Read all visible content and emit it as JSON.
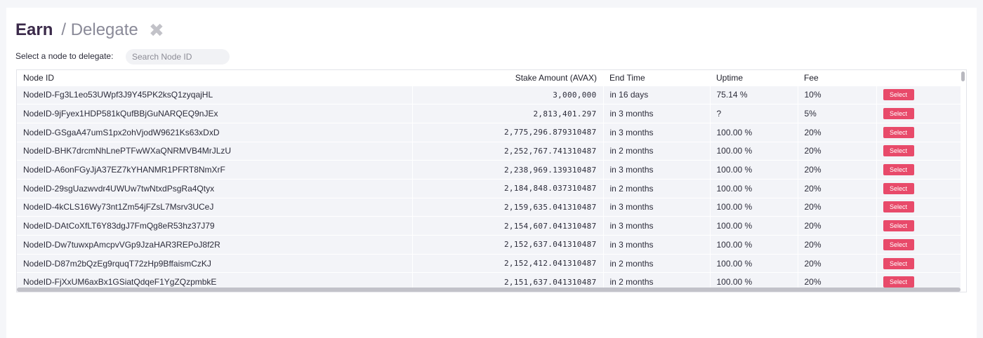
{
  "header": {
    "title": "Earn",
    "subtitle": "/ Delegate",
    "close_icon": "✖"
  },
  "search": {
    "label": "Select a node to delegate:",
    "placeholder": "Search Node ID",
    "value": ""
  },
  "table": {
    "columns": [
      "Node ID",
      "Stake Amount (AVAX)",
      "End Time",
      "Uptime",
      "Fee"
    ],
    "select_label": "Select",
    "rows": [
      {
        "node_id": "NodeID-Fg3L1eo53UWpf3J9Y45PK2ksQ1zyqajHL",
        "stake": "3,000,000",
        "end_time": "in 16 days",
        "uptime": "75.14 %",
        "fee": "10%"
      },
      {
        "node_id": "NodeID-9jFyex1HDP581kQufBBjGuNARQEQ9nJEx",
        "stake": "2,813,401.297",
        "end_time": "in 3 months",
        "uptime": "?",
        "fee": "5%"
      },
      {
        "node_id": "NodeID-GSgaA47umS1px2ohVjodW9621Ks63xDxD",
        "stake": "2,775,296.879310487",
        "end_time": "in 3 months",
        "uptime": "100.00 %",
        "fee": "20%"
      },
      {
        "node_id": "NodeID-BHK7drcmNhLnePTFwWXaQNRMVB4MrJLzU",
        "stake": "2,252,767.741310487",
        "end_time": "in 2 months",
        "uptime": "100.00 %",
        "fee": "20%"
      },
      {
        "node_id": "NodeID-A6onFGyJjA37EZ7kYHANMR1PFRT8NmXrF",
        "stake": "2,238,969.139310487",
        "end_time": "in 3 months",
        "uptime": "100.00 %",
        "fee": "20%"
      },
      {
        "node_id": "NodeID-29sgUazwvdr4UWUw7twNtxdPsgRa4Qtyx",
        "stake": "2,184,848.037310487",
        "end_time": "in 2 months",
        "uptime": "100.00 %",
        "fee": "20%"
      },
      {
        "node_id": "NodeID-4kCLS16Wy73nt1Zm54jFZsL7Msrv3UCeJ",
        "stake": "2,159,635.041310487",
        "end_time": "in 3 months",
        "uptime": "100.00 %",
        "fee": "20%"
      },
      {
        "node_id": "NodeID-DAtCoXfLT6Y83dgJ7FmQg8eR53hz37J79",
        "stake": "2,154,607.041310487",
        "end_time": "in 3 months",
        "uptime": "100.00 %",
        "fee": "20%"
      },
      {
        "node_id": "NodeID-Dw7tuwxpAmcpvVGp9JzaHAR3REPoJ8f2R",
        "stake": "2,152,637.041310487",
        "end_time": "in 3 months",
        "uptime": "100.00 %",
        "fee": "20%"
      },
      {
        "node_id": "NodeID-D87m2bQzEg9rquqT72zHp9BffaismCzKJ",
        "stake": "2,152,412.041310487",
        "end_time": "in 2 months",
        "uptime": "100.00 %",
        "fee": "20%"
      },
      {
        "node_id": "NodeID-FjXxUM6axBx1GSiatQdqeF1YgZQzpmbkE",
        "stake": "2,151,637.041310487",
        "end_time": "in 2 months",
        "uptime": "100.00 %",
        "fee": "20%"
      }
    ]
  },
  "colors": {
    "accent": "#e84a6a",
    "title": "#3b2a4a",
    "row_bg": "#f3f4f8"
  }
}
